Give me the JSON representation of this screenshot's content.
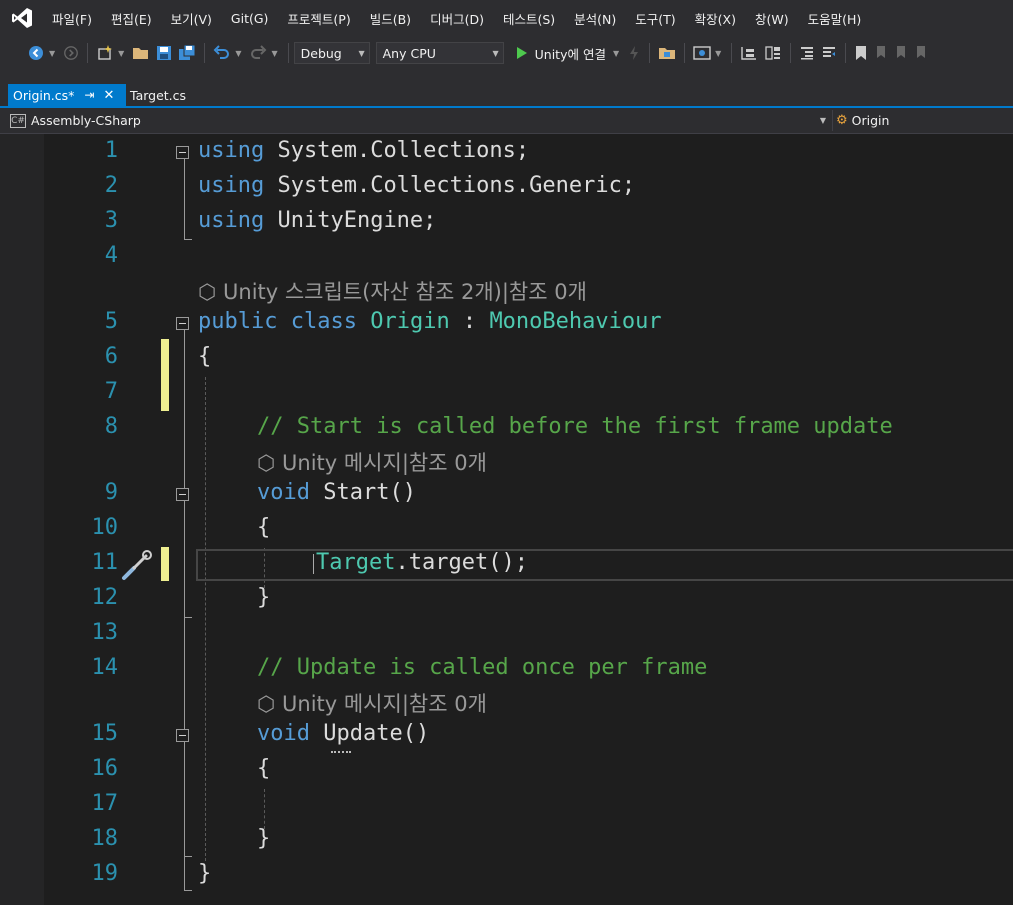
{
  "menu": [
    "파일(F)",
    "편집(E)",
    "보기(V)",
    "Git(G)",
    "프로젝트(P)",
    "빌드(B)",
    "디버그(D)",
    "테스트(S)",
    "분석(N)",
    "도구(T)",
    "확장(X)",
    "창(W)",
    "도움말(H)"
  ],
  "toolbar": {
    "configuration": "Debug",
    "platform": "Any CPU",
    "run_label": "Unity에 연결"
  },
  "tabs": [
    {
      "label": "Origin.cs*",
      "active": true,
      "pinned": true
    },
    {
      "label": "Target.cs",
      "active": false
    }
  ],
  "navbar": {
    "project": "Assembly-CSharp",
    "type_scope": "Origin"
  },
  "editor": {
    "line_numbers": [
      "1",
      "2",
      "3",
      "4",
      "5",
      "6",
      "7",
      "8",
      "9",
      "10",
      "11",
      "12",
      "13",
      "14",
      "15",
      "16",
      "17",
      "18",
      "19"
    ],
    "lines": {
      "l1": {
        "kw": "using",
        "rest": " System.Collections;"
      },
      "l2": {
        "kw": "using",
        "rest": " System.Collections.Generic;"
      },
      "l3": {
        "kw": "using",
        "rest": " UnityEngine;"
      },
      "l5": {
        "kw1": "public",
        "kw2": " class",
        "name": " Origin",
        "colon": " : ",
        "base": "MonoBehaviour"
      },
      "l6": "{",
      "l8": "// Start is called before the first frame update",
      "l9": {
        "kw": "void",
        "rest": " Start()"
      },
      "l10": "{",
      "l11": {
        "type": "Target",
        "rest": ".target();"
      },
      "l12": "}",
      "l14": "// Update is called once per frame",
      "l15": {
        "kw": "void",
        "rest": " Update()"
      },
      "l16": "{",
      "l18": "}",
      "l19": "}"
    },
    "codelens": {
      "class": "Unity 스크립트(자산 참조 2개)|참조 0개",
      "start": "Unity 메시지|참조 0개",
      "update": "Unity 메시지|참조 0개"
    }
  },
  "colors": {
    "keyword": "#569cd6",
    "type": "#4ec9b0",
    "comment": "#57a64a",
    "line_number": "#2b91af",
    "accent": "#007acc",
    "change_marker": "#efef91"
  }
}
